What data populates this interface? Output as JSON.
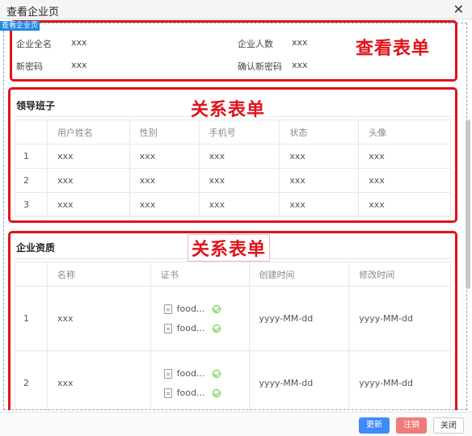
{
  "window": {
    "title": "查看企业页"
  },
  "selection_tag": "查看企业页",
  "annotations": {
    "view_form": "查看表单",
    "relation_form_1": "关系表单",
    "relation_form_2": "关系表单"
  },
  "view_form": {
    "fields": [
      {
        "label": "企业全名",
        "value": "xxx"
      },
      {
        "label": "企业人数",
        "value": "xxx"
      },
      {
        "label": "新密码",
        "value": "xxx"
      },
      {
        "label": "确认新密码",
        "value": "xxx"
      }
    ]
  },
  "leaders": {
    "title": "领导班子",
    "columns": [
      "",
      "用户姓名",
      "性别",
      "手机号",
      "状态",
      "头像"
    ],
    "rows": [
      [
        "1",
        "xxx",
        "xxx",
        "xxx",
        "xxx",
        "xxx"
      ],
      [
        "2",
        "xxx",
        "xxx",
        "xxx",
        "xxx",
        "xxx"
      ],
      [
        "3",
        "xxx",
        "xxx",
        "xxx",
        "xxx",
        "xxx"
      ]
    ]
  },
  "qualifications": {
    "title": "企业资质",
    "columns": [
      "",
      "名称",
      "证书",
      "创建时间",
      "修改时间"
    ],
    "rows": [
      {
        "idx": "1",
        "name": "xxx",
        "files": [
          "food...",
          "food..."
        ],
        "created": "yyyy-MM-dd",
        "modified": "yyyy-MM-dd"
      },
      {
        "idx": "2",
        "name": "xxx",
        "files": [
          "food...",
          "food..."
        ],
        "created": "yyyy-MM-dd",
        "modified": "yyyy-MM-dd"
      }
    ]
  },
  "footer": {
    "update": "更新",
    "cancel": "注销",
    "close": "关闭"
  },
  "colors": {
    "annotation_red": "#e0121a",
    "primary": "#3d8bfd",
    "danger": "#f07a7a",
    "success": "#52c41a"
  },
  "icons": [
    "close-icon",
    "document-icon",
    "check-circle-icon"
  ]
}
